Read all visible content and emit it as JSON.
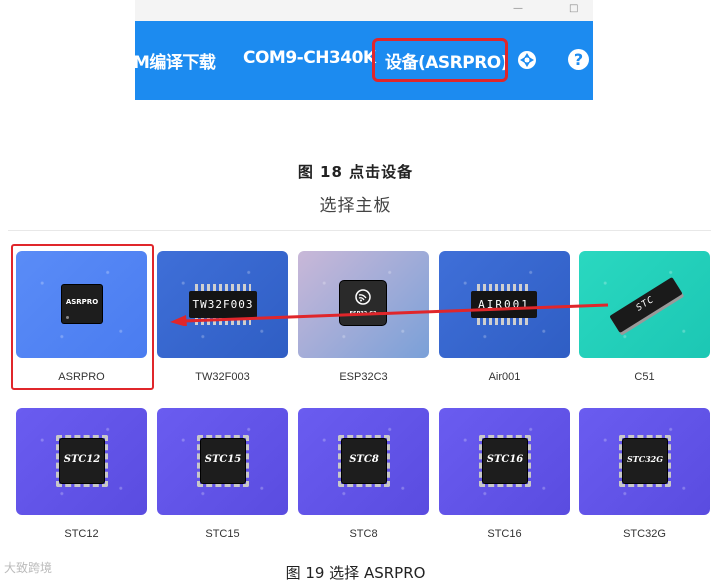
{
  "figure18": {
    "toolbar": {
      "items": [
        {
          "label": "M编译下载"
        },
        {
          "label": "COM9-CH340K"
        },
        {
          "label": "设备(ASRPRO)"
        }
      ],
      "window_controls": [
        "—",
        "□"
      ],
      "help_symbol": "?"
    },
    "caption": "图  18    点击设备"
  },
  "subtitle": "选择主板",
  "figure19": {
    "boards": [
      {
        "label": "ASRPRO",
        "chip_text": "ASRPRO",
        "selected": true
      },
      {
        "label": "TW32F003",
        "chip_text": "TW32F003"
      },
      {
        "label": "ESP32C3",
        "chip_text": "ESP32-C3"
      },
      {
        "label": "Air001",
        "chip_text": "AIR001"
      },
      {
        "label": "C51",
        "chip_text": "STC"
      },
      {
        "label": "STC12",
        "chip_text": "STC12"
      },
      {
        "label": "STC15",
        "chip_text": "STC15"
      },
      {
        "label": "STC8",
        "chip_text": "STC8"
      },
      {
        "label": "STC16",
        "chip_text": "STC16"
      },
      {
        "label": "STC32G",
        "chip_text": "STC32G"
      }
    ],
    "caption": "图  19  选择 ASRPRO"
  },
  "watermark": "大致跨境",
  "colors": {
    "toolbar_blue": "#1c8bf0",
    "highlight_red": "#e0262b"
  }
}
